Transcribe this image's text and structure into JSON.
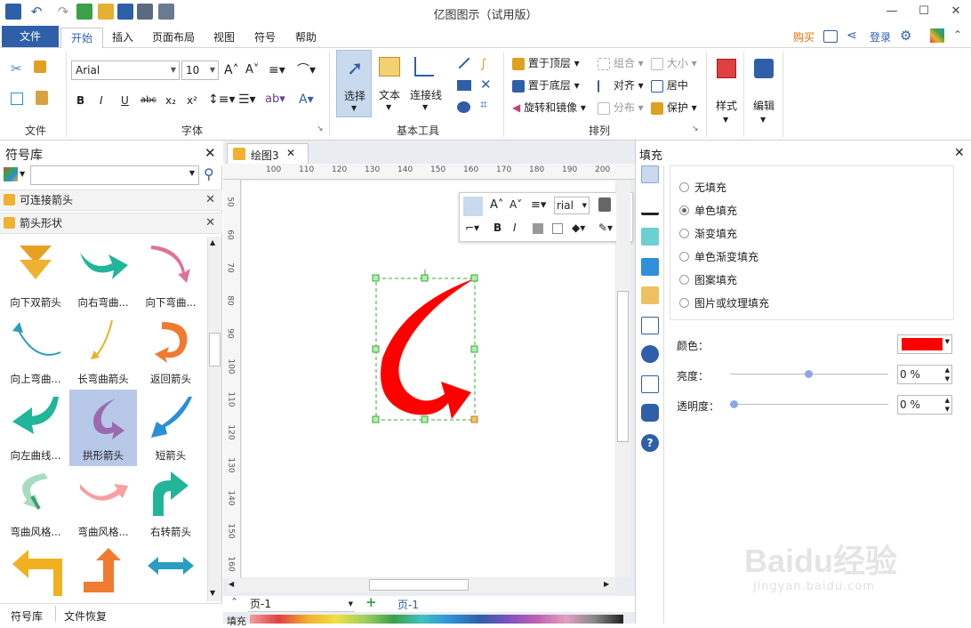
{
  "app": {
    "title": "亿图图示（试用版）",
    "colors": {
      "accent": "#2f5fa8",
      "arrow": "#ff0000",
      "selection": "#2db32d",
      "buy": "#e07000"
    }
  },
  "menu": {
    "tabs": [
      {
        "label": "文件"
      },
      {
        "label": "开始"
      },
      {
        "label": "插入"
      },
      {
        "label": "页面布局"
      },
      {
        "label": "视图"
      },
      {
        "label": "符号"
      },
      {
        "label": "帮助"
      }
    ],
    "right": {
      "buy": "购买",
      "login": "登录"
    }
  },
  "ribbon": {
    "groups": {
      "file": "文件",
      "font": "字体",
      "basic_tools": "基本工具",
      "arrange": "排列"
    },
    "font": {
      "family": "Arial",
      "size": "10"
    },
    "tools": {
      "select": "选择",
      "text": "文本",
      "connector": "连接线"
    },
    "arrange": {
      "bring_top": "置于顶层",
      "send_bottom": "置于底层",
      "rotate_mirror": "旋转和镜像",
      "group": "组合",
      "align": "对齐",
      "distribute": "分布",
      "size": "大小",
      "center": "居中",
      "protect": "保护"
    },
    "style": "样式",
    "edit": "编辑"
  },
  "library": {
    "title": "符号库",
    "search_placeholder": "",
    "categories": [
      {
        "label": "可连接箭头"
      },
      {
        "label": "箭头形状"
      }
    ],
    "shapes": [
      {
        "label": "向下双箭头"
      },
      {
        "label": "向右弯曲..."
      },
      {
        "label": "向下弯曲..."
      },
      {
        "label": "向上弯曲..."
      },
      {
        "label": "长弯曲箭头"
      },
      {
        "label": "返回箭头"
      },
      {
        "label": "向左曲线..."
      },
      {
        "label": "拱形箭头"
      },
      {
        "label": "短箭头"
      },
      {
        "label": "弯曲风格..."
      },
      {
        "label": "弯曲风格..."
      },
      {
        "label": "右转箭头"
      }
    ],
    "bottom_tabs": {
      "library": "符号库",
      "recovery": "文件恢复"
    }
  },
  "canvas": {
    "doc_tab": "绘图3",
    "ruler_h": [
      "100",
      "110",
      "120",
      "130",
      "140",
      "150",
      "160",
      "170",
      "180",
      "190",
      "200"
    ],
    "ruler_v": [
      "50",
      "60",
      "70",
      "80",
      "90",
      "100",
      "110",
      "120",
      "130",
      "140",
      "150",
      "160"
    ],
    "page_select": "页-1",
    "page_tab": "页-1",
    "fill_label": "填充",
    "float_toolbar": {
      "font": "rial"
    }
  },
  "fill_panel": {
    "title": "填充",
    "options": [
      {
        "label": "无填充",
        "selected": false
      },
      {
        "label": "单色填充",
        "selected": true
      },
      {
        "label": "渐变填充",
        "selected": false
      },
      {
        "label": "单色渐变填充",
        "selected": false
      },
      {
        "label": "图案填充",
        "selected": false
      },
      {
        "label": "图片或纹理填充",
        "selected": false
      }
    ],
    "color_label": "颜色：",
    "color_value": "#ff0000",
    "brightness_label": "亮度：",
    "brightness_value": "0 %",
    "opacity_label": "透明度：",
    "opacity_value": "0 %"
  },
  "watermark": {
    "brand": "Baidu经验",
    "url": "jingyan.baidu.com"
  }
}
